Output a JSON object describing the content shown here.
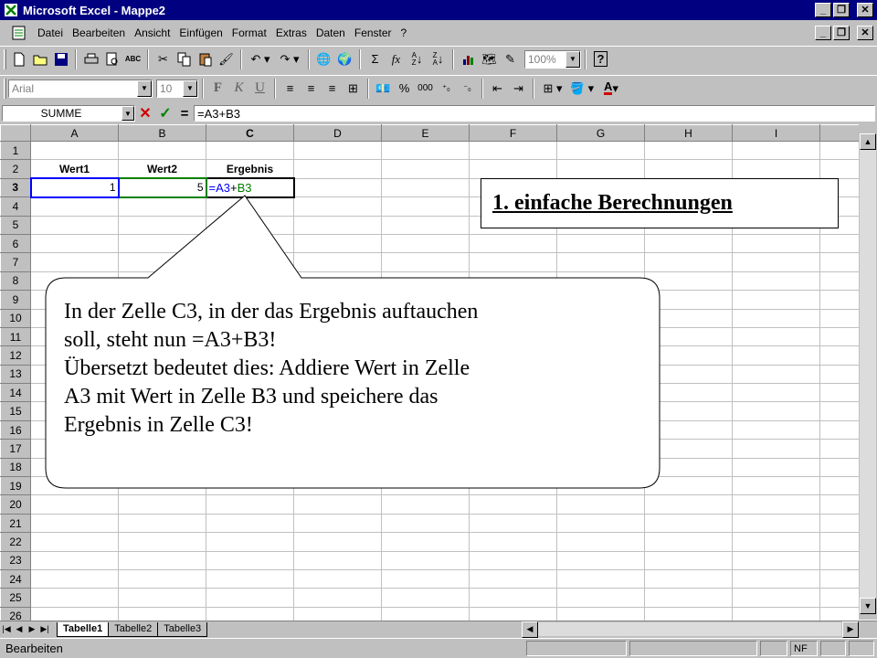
{
  "window": {
    "title": "Microsoft Excel - Mappe2"
  },
  "menu": [
    "Datei",
    "Bearbeiten",
    "Ansicht",
    "Einfügen",
    "Format",
    "Extras",
    "Daten",
    "Fenster",
    "?"
  ],
  "toolbar": {
    "zoom": "100%",
    "font_name": "Arial",
    "font_size": "10",
    "sum_symbol": "Σ",
    "fx_symbol": "fx",
    "bold": "F",
    "italic": "K",
    "underline": "U",
    "percent": "%",
    "thousands": "000"
  },
  "formula_bar": {
    "name_box": "SUMME",
    "cancel": "✕",
    "enter": "✓",
    "equals": "=",
    "formula": "=A3+B3"
  },
  "sheet": {
    "columns": [
      "A",
      "B",
      "C",
      "D",
      "E",
      "F",
      "G",
      "H",
      "I"
    ],
    "rows": [
      "1",
      "2",
      "3",
      "4",
      "5",
      "6",
      "7",
      "8",
      "9",
      "10",
      "11",
      "12",
      "13",
      "14",
      "15",
      "16",
      "17",
      "18",
      "19",
      "20",
      "21",
      "22",
      "23",
      "24",
      "25",
      "26"
    ],
    "headers": {
      "a2": "Wert1",
      "b2": "Wert2",
      "c2": "Ergebnis"
    },
    "values": {
      "a3": "1",
      "b3": "5"
    },
    "edit": {
      "ref1": "=A3",
      "plus": "+",
      "ref2": "B3"
    }
  },
  "tabs": [
    "Tabelle1",
    "Tabelle2",
    "Tabelle3"
  ],
  "status": {
    "mode": "Bearbeiten",
    "nf": "NF"
  },
  "colors": {
    "ref1": "#0000ff",
    "ref2": "#008000",
    "titlebar": "#000080"
  },
  "annotations": {
    "heading": "1. einfache Berechnungen",
    "callout_lines": [
      "In der Zelle C3, in der das Ergebnis auftauchen",
      "soll, steht nun =A3+B3!",
      "Übersetzt bedeutet dies: Addiere Wert in Zelle",
      "A3 mit Wert in Zelle B3 und speichere das",
      "Ergebnis in Zelle C3!"
    ]
  }
}
